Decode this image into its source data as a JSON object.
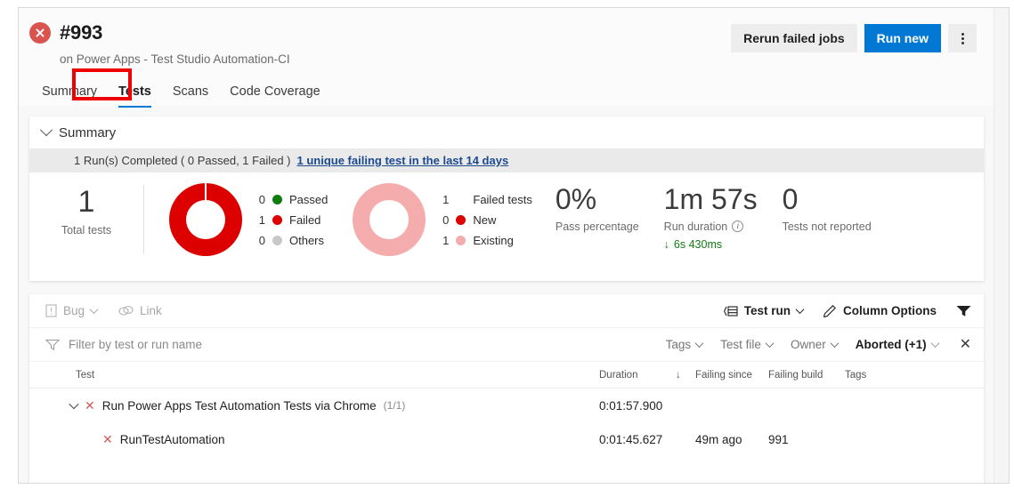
{
  "header": {
    "status_icon": "failed-x-circle-icon",
    "build_number": "#993",
    "subtitle": "on Power Apps - Test Studio Automation-CI",
    "rerun_label": "Rerun failed jobs",
    "run_new_label": "Run new",
    "more_label": "more-actions-icon"
  },
  "tabs": [
    {
      "label": "Summary",
      "active": false
    },
    {
      "label": "Tests",
      "active": true
    },
    {
      "label": "Scans",
      "active": false
    },
    {
      "label": "Code Coverage",
      "active": false
    }
  ],
  "annotation": {
    "target": "Tests",
    "color": "#ee0000"
  },
  "summary": {
    "section_title": "Summary",
    "runs_text": "1 Run(s) Completed ( 0 Passed, 1 Failed )",
    "failing_link": "1 unique failing test in the last 14 days",
    "total_tests": {
      "value": "1",
      "label": "Total tests"
    },
    "outcome_chart": {
      "legend": [
        {
          "count": "0",
          "label": "Passed",
          "color": "#107c10"
        },
        {
          "count": "1",
          "label": "Failed",
          "color": "#dc0000"
        },
        {
          "count": "0",
          "label": "Others",
          "color": "#c8c8c8"
        }
      ]
    },
    "failure_chart": {
      "legend": [
        {
          "count": "1",
          "label": "Failed tests",
          "color": ""
        },
        {
          "count": "0",
          "label": "New",
          "color": "#dc0000"
        },
        {
          "count": "1",
          "label": "Existing",
          "color": "#f4acac"
        }
      ]
    },
    "metrics": [
      {
        "value": "0%",
        "label": "Pass percentage",
        "info": false,
        "delta": ""
      },
      {
        "value": "1m 57s",
        "label": "Run duration",
        "info": true,
        "delta": "6s 430ms",
        "delta_dir": "down"
      },
      {
        "value": "0",
        "label": "Tests not reported",
        "info": false,
        "delta": ""
      }
    ]
  },
  "results": {
    "toolbar": {
      "bug_label": "Bug",
      "bug_icon": "bug-work-item-icon",
      "link_label": "Link",
      "link_icon": "link-icon",
      "test_run_label": "Test run",
      "test_run_icon": "group-by-icon",
      "column_options_label": "Column Options",
      "column_options_icon": "pencil-icon",
      "filter_icon": "funnel-icon"
    },
    "filter": {
      "placeholder": "Filter by test or run name",
      "filter_icon": "funnel-outline-icon",
      "pills": [
        {
          "label": "Tags",
          "active": false
        },
        {
          "label": "Test file",
          "active": false
        },
        {
          "label": "Owner",
          "active": false
        },
        {
          "label": "Aborted (+1)",
          "active": true
        }
      ],
      "clear_icon": "close-icon"
    },
    "columns": [
      "Test",
      "Duration",
      "Failing since",
      "Failing build",
      "Tags"
    ],
    "sort": {
      "column": "Duration",
      "direction": "down",
      "glyph": "↓"
    },
    "rows": [
      {
        "level": 1,
        "expanded": true,
        "status_icon": "failed-x-icon",
        "test": "Run Power Apps Test Automation Tests via Chrome",
        "count": "(1/1)",
        "duration": "0:01:57.900",
        "failing_since": "",
        "failing_build": "",
        "tags": ""
      },
      {
        "level": 2,
        "expanded": false,
        "status_icon": "failed-x-icon",
        "test": "RunTestAutomation",
        "count": "",
        "duration": "0:01:45.627",
        "failing_since": "49m ago",
        "failing_build": "991",
        "tags": ""
      }
    ]
  }
}
